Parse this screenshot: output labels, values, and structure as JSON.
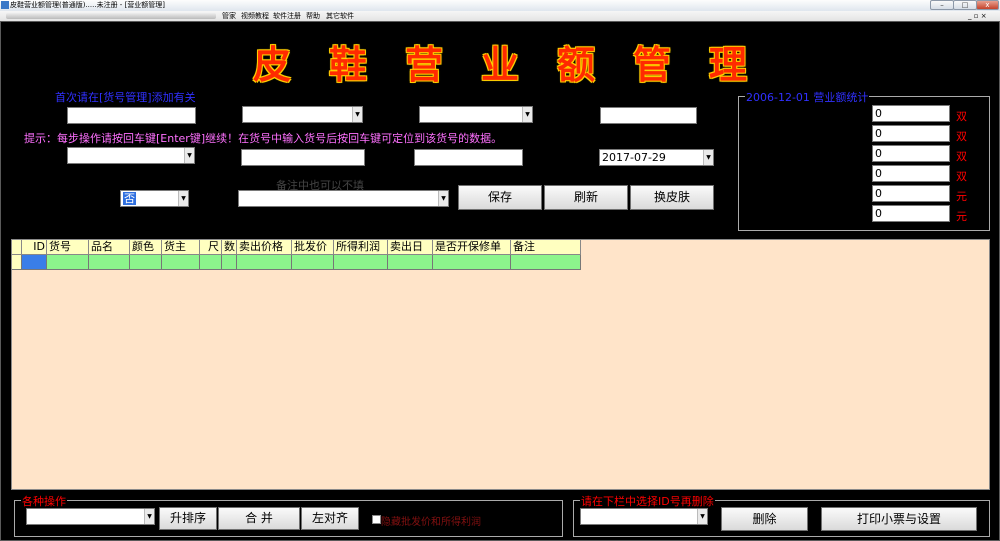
{
  "window": {
    "title": "皮鞋营业额管理(普通版).....未注册 - [营业额管理]",
    "minimize": "–",
    "maximize": "□",
    "close": "x"
  },
  "menu": {
    "items": [
      "管家",
      "视频教程",
      "软件注册",
      "帮助",
      "其它软件"
    ],
    "mdi_controls": "_ ▫ ×"
  },
  "title": "皮鞋营业额管理",
  "hints": {
    "first_time": "首次请在[货号管理]添加有关",
    "tip": "提示：每步操作请按回车键[Enter键]继续！在货号中输入货号后按回车键可定位到该货号的数据。",
    "remark": "备注中也可以不填"
  },
  "inputs": {
    "date": "2017-07-29",
    "yes_no": "否"
  },
  "buttons": {
    "save": "保存",
    "refresh": "刷新",
    "skin": "换皮肤",
    "sort_asc": "升排序",
    "merge": "合 并",
    "align_left": "左对齐",
    "delete": "删除",
    "print": "打印小票与设置"
  },
  "summary": {
    "legend": "2006-12-01 营业额统计",
    "values": [
      "0",
      "0",
      "0",
      "0",
      "0",
      "0"
    ],
    "units": [
      "双",
      "双",
      "双",
      "双",
      "元",
      "元"
    ]
  },
  "grid": {
    "columns": [
      "ID",
      "货号",
      "品名",
      "颜色",
      "货主",
      "尺",
      "数",
      "卖出价格",
      "批发价",
      "所得利润",
      "卖出日",
      "是否开保修单",
      "备注"
    ]
  },
  "ops": {
    "legend": "各种操作",
    "checkbox_label": "隐藏批发价和所得利润"
  },
  "delete_panel": {
    "legend": "请在下栏中选择ID号再删除"
  },
  "colors": {
    "background": "#000000",
    "title": "#ff2a00",
    "grid_bg": "#ffe4c9",
    "grid_header": "#ffffc0",
    "grid_row": "#8cf58c",
    "hint_blue": "#3030ff",
    "tip_magenta": "#ff70ff",
    "legend_red": "#ff0000"
  }
}
